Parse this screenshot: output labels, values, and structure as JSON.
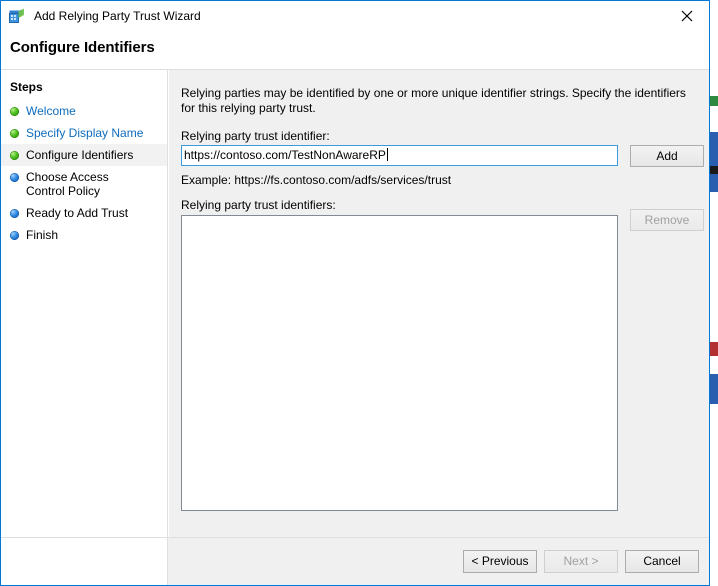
{
  "window": {
    "title": "Add Relying Party Trust Wizard",
    "icon": "relying-party-trust-wizard-icon",
    "close_icon": "close-icon",
    "accent_color": "#0078d7"
  },
  "page": {
    "heading": "Configure Identifiers"
  },
  "sidebar": {
    "title": "Steps",
    "items": [
      {
        "label": "Welcome",
        "bullet": "green",
        "state": "completed",
        "link": true
      },
      {
        "label": "Specify Display Name",
        "bullet": "green",
        "state": "completed",
        "link": true
      },
      {
        "label": "Configure Identifiers",
        "bullet": "green",
        "state": "current",
        "link": false
      },
      {
        "label": "Choose Access Control Policy",
        "bullet": "blue",
        "state": "pending",
        "link": false
      },
      {
        "label": "Ready to Add Trust",
        "bullet": "blue",
        "state": "pending",
        "link": false
      },
      {
        "label": "Finish",
        "bullet": "blue",
        "state": "pending",
        "link": false
      }
    ],
    "bullet_colors": {
      "green": "#4fbf1e",
      "blue": "#2f8ae0"
    }
  },
  "main": {
    "intro": "Relying parties may be identified by one or more unique identifier strings. Specify the identifiers for this relying party trust.",
    "identifier_label": "Relying party trust identifier:",
    "identifier_value": "https://contoso.com/TestNonAwareRP",
    "identifier_placeholder": "",
    "example_text": "Example: https://fs.contoso.com/adfs/services/trust",
    "list_label": "Relying party trust identifiers:",
    "list_items": [],
    "add_button": "Add",
    "remove_button": "Remove",
    "remove_disabled": true
  },
  "footer": {
    "previous_button": "< Previous",
    "next_button": "Next >",
    "cancel_button": "Cancel",
    "next_disabled": true
  }
}
